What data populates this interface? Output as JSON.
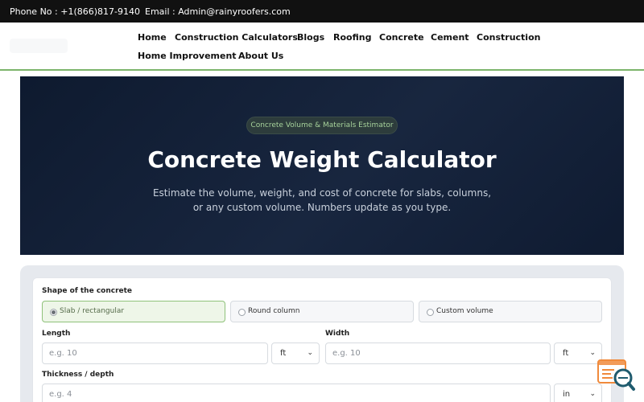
{
  "topbar": {
    "phone": "Phone No : +1(866)817-9140",
    "email": "Email : Admin@rainyroofers.com"
  },
  "nav": {
    "items": [
      "Home",
      "Construction Calculators",
      "Blogs",
      "Roofing",
      "Concrete",
      "Cement",
      "Construction",
      "Home Improvement",
      "About Us"
    ]
  },
  "hero": {
    "pill": "Concrete Volume & Materials Estimator",
    "title": "Concrete Weight Calculator",
    "subtitle_line1": "Estimate the volume, weight, and cost of concrete for slabs, columns,",
    "subtitle_line2": "or any custom volume. Numbers update as you type."
  },
  "form": {
    "shape_label": "Shape of the concrete",
    "shapes": [
      "Slab / rectangular",
      "Round column",
      "Custom volume"
    ],
    "selected_shape": "Slab / rectangular",
    "length_label": "Length",
    "length_placeholder": "e.g. 10",
    "length_unit": "ft",
    "width_label": "Width",
    "width_placeholder": "e.g. 10",
    "width_unit": "ft",
    "thickness_label": "Thickness / depth",
    "thickness_placeholder": "e.g. 4",
    "thickness_unit": "in"
  },
  "colors": {
    "topbar_bg": "#111111",
    "accent_green": "#7cb46b",
    "hero_bg": "#0e1a2f",
    "widget_orange": "#f08a3c",
    "widget_teal": "#1f5b6e"
  },
  "icons": {
    "widget": "search-chat-icon",
    "dropdown": "chevron-down-icon",
    "radio": "radio-icon"
  }
}
